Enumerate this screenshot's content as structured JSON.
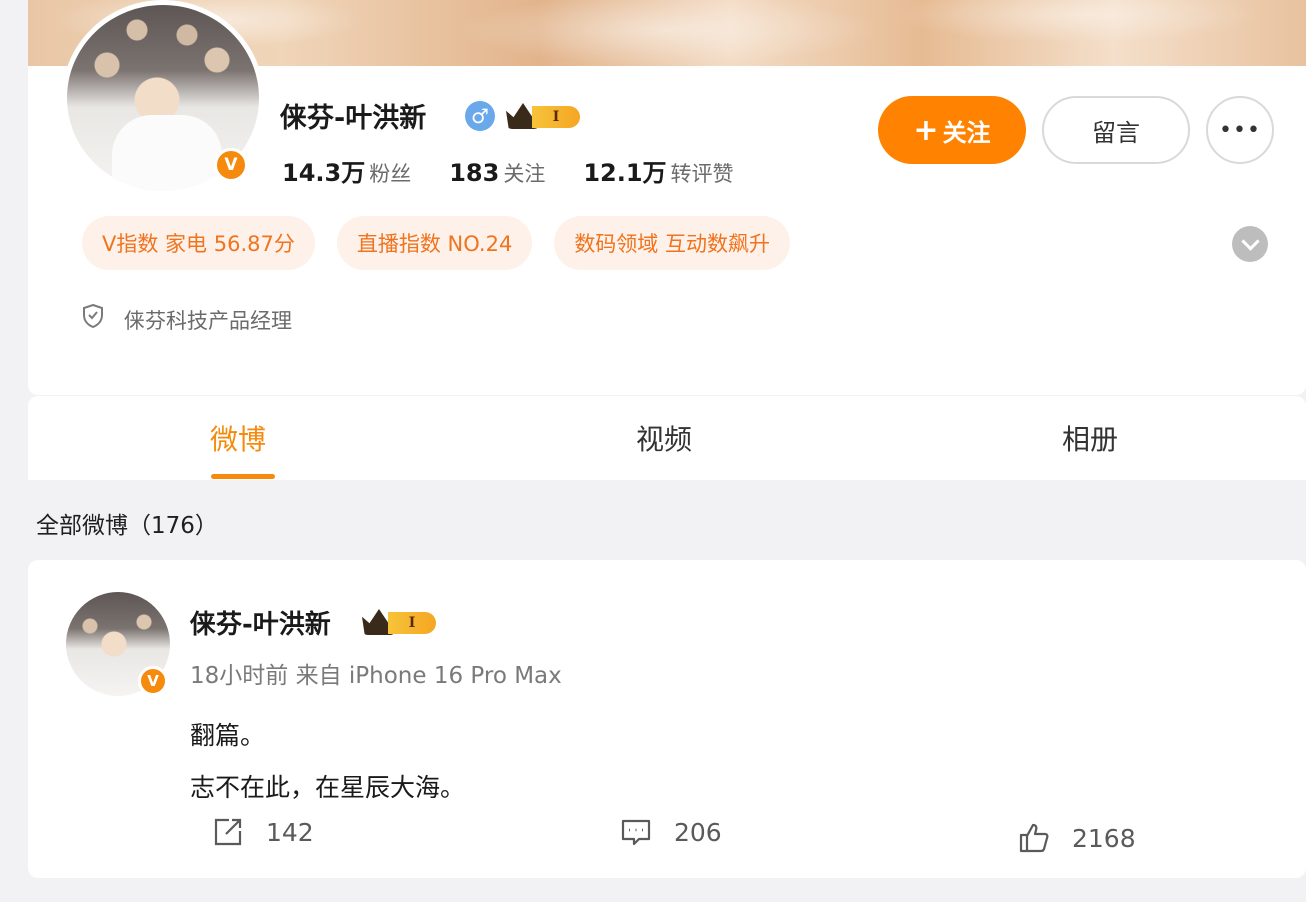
{
  "profile": {
    "username": "俫芬-叶洪新",
    "gender_icon": "male-icon",
    "gender_symbol": "♂",
    "level_badge": "I",
    "verified_badge": "V",
    "stats": [
      {
        "num": "14.3万",
        "label": "粉丝"
      },
      {
        "num": "183",
        "label": "关注"
      },
      {
        "num": "12.1万",
        "label": "转评赞"
      }
    ],
    "follow_label": "关注",
    "follow_plus": "+",
    "message_label": "留言",
    "more_label": "•••",
    "tags": [
      "V指数 家电 56.87分",
      "直播指数 NO.24",
      "数码领域 互动数飙升"
    ],
    "job": "俫芬科技产品经理"
  },
  "tabs": [
    "微博",
    "视频",
    "相册"
  ],
  "all_posts_label": "全部微博（176）",
  "post": {
    "username": "俫芬-叶洪新",
    "level_badge": "I",
    "verified_badge": "V",
    "meta": "18小时前 来自 iPhone 16 Pro Max",
    "lines": [
      "翻篇。",
      "志不在此，在星辰大海。"
    ],
    "repost_count": "142",
    "comment_count": "206",
    "like_count": "2168"
  },
  "colors": {
    "accent": "#ff8200",
    "tag_bg": "#fdf1ea",
    "tag_text": "#f0741e",
    "male_blue": "#6aa8ec"
  }
}
